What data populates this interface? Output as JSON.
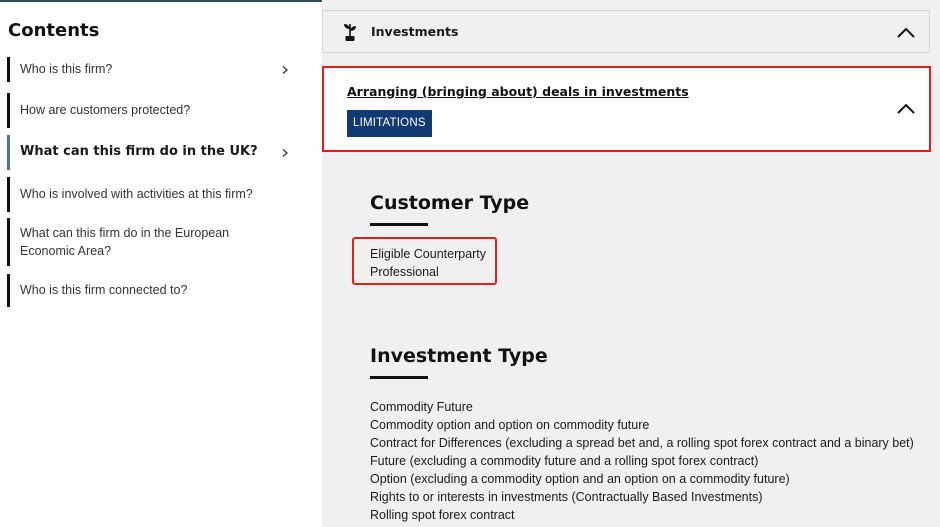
{
  "sidebar": {
    "heading": "Contents",
    "items": [
      {
        "label": "Who is this firm?",
        "has_chevron": true
      },
      {
        "label": "How are customers protected?",
        "has_chevron": false
      },
      {
        "label": "What can this firm do in the UK?",
        "has_chevron": true,
        "active": true
      },
      {
        "label": "Who is involved with activities at this firm?",
        "has_chevron": false
      },
      {
        "label": "What can this firm do in the European Economic Area?",
        "has_chevron": false
      },
      {
        "label": "Who is this firm connected to?",
        "has_chevron": false
      }
    ]
  },
  "panel": {
    "investments_header": {
      "title": "Investments",
      "icon": "plant-icon",
      "expanded": true
    },
    "deal": {
      "title": "Arranging (bringing about) deals in investments",
      "badge": "LIMITATIONS",
      "expanded": true
    },
    "customer_type": {
      "title": "Customer Type",
      "values": [
        "Eligible Counterparty",
        "Professional"
      ]
    },
    "investment_type": {
      "title": "Investment Type",
      "values": [
        "Commodity Future",
        "Commodity option and option on commodity future",
        "Contract for Differences (excluding a spread bet and, a rolling spot forex contract and a binary bet)",
        "Future (excluding a commodity future and a rolling spot forex contract)",
        "Option (excluding a commodity option and an option on a commodity future)",
        "Rights to or interests in investments (Contractually Based Investments)",
        "Rolling spot forex contract"
      ]
    }
  },
  "colors": {
    "highlight_border": "#e02020",
    "badge_bg": "#123a72",
    "active_indicator": "#4a7c7d",
    "panel_bg": "#f0f0f0"
  }
}
